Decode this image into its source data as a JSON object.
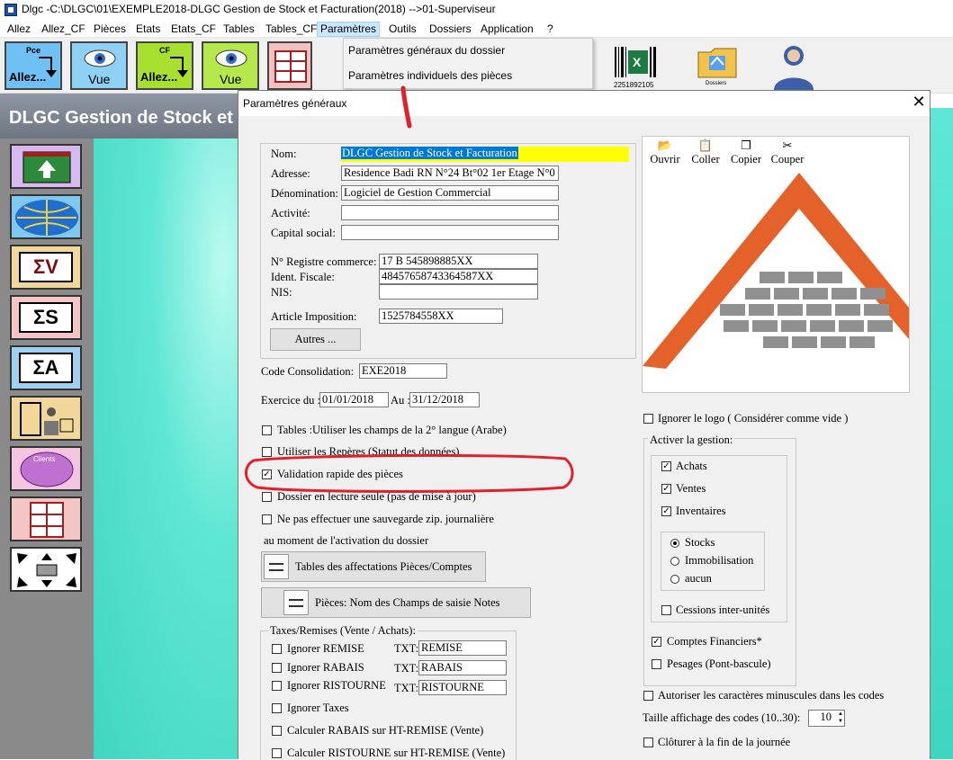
{
  "window": {
    "title": "Dlgc -C:\\DLGC\\01\\EXEMPLE2018-DLGC Gestion de Stock et Facturation(2018) -->01-Superviseur"
  },
  "menu": [
    "Allez",
    "Allez_CF",
    "Pièces",
    "Etats",
    "Etats_CF",
    "Tables",
    "Tables_CF",
    "Paramètres",
    "Outils",
    "Dossiers",
    "Application",
    "?"
  ],
  "toolbar": {
    "pce_label": "Pce",
    "allez_label": "Allez...",
    "vue_label": "Vue",
    "cf_label": "CF",
    "barcode_digits": "2251892105",
    "dossiers_label": "Dossiers"
  },
  "dropdown": {
    "item1": "Paramètres généraux du dossier",
    "item2": "Paramètres individuels des pièces"
  },
  "app": {
    "banner": "DLGC Gestion de Stock et Facturation",
    "clients_label": "Clients"
  },
  "dialog": {
    "title": "Paramètres généraux",
    "close": "✕",
    "fields": {
      "nom_label": "Nom:",
      "nom_value": "DLGC Gestion de Stock et Facturation",
      "adresse_label": "Adresse:",
      "adresse_value": "Residence Badi RN N°24 Bt°02 1er Etage N°0",
      "denomination_label": "Dénomination:",
      "denomination_value": "Logiciel de Gestion Commercial",
      "activite_label": "Activité:",
      "activite_value": "",
      "capital_label": "Capital social:",
      "capital_value": "",
      "rc_label": "N° Registre commerce:",
      "rc_value": "17 B 545898885XX",
      "if_label": "Ident. Fiscale:",
      "if_value": "48457658743364587XX",
      "nis_label": "NIS:",
      "nis_value": "",
      "article_label": "Article Imposition:",
      "article_value": "1525784558XX",
      "autres_button": "Autres ..."
    },
    "consolidation_label": "Code Consolidation:",
    "consolidation_value": "EXE2018",
    "exercice_label": "Exercice du :",
    "exercice_from": "01/01/2018",
    "au_label": "Au :",
    "exercice_to": "31/12/2018",
    "options": {
      "tables_arabe": "Tables :Utiliser les champs de la 2° langue (Arabe)",
      "reperes": "Utiliser les Repères (Statut des données)",
      "validation": "Validation rapide des pièces",
      "lecture_seule": "Dossier en lecture seule (pas de mise à jour)",
      "sauvegarde": "Ne pas effectuer une sauvegarde zip. journalière",
      "sauvegarde_note": "au moment de l'activation du dossier"
    },
    "btn_affectations": "Tables des affectations Pièces/Comptes",
    "btn_champs": "Pièces: Nom des Champs de saisie Notes",
    "taxes": {
      "legend": "Taxes/Remises (Vente / Achats):",
      "ignorer_remise": "Ignorer REMISE",
      "ignorer_rabais": "Ignorer RABAIS",
      "ignorer_ristourne": "Ignorer RISTOURNE",
      "txt_label": "TXT:",
      "txt_remise": "REMISE",
      "txt_rabais": "RABAIS",
      "txt_ristourne": "RISTOURNE",
      "ignorer_taxes": "Ignorer Taxes",
      "calc_rabais": "Calculer RABAIS sur HT-REMISE (Vente)",
      "calc_ristourne": "Calculer RISTOURNE sur HT-REMISE (Vente)"
    },
    "logo_tools": {
      "ouvrir": "Ouvrir",
      "coller": "Coller",
      "copier": "Copier",
      "couper": "Couper"
    },
    "ignorer_logo": "Ignorer le logo ( Considérer comme vide )",
    "gestion": {
      "legend": "Activer la gestion:",
      "achats": "Achats",
      "ventes": "Ventes",
      "inventaires": "Inventaires",
      "stocks": "Stocks",
      "immobilisation": "Immobilisation",
      "aucun": "aucun",
      "cessions": "Cessions inter-unités",
      "comptes_financiers": "Comptes Financiers*",
      "pesages": "Pesages (Pont-bascule)"
    },
    "minuscules": "Autoriser les caractères minuscules dans les codes",
    "taille_label": "Taille affichage des codes (10..30):",
    "taille_value": "10",
    "cloturer": "Clôturer à la fin de la journée"
  },
  "colors": {
    "highlight": "#ffff00",
    "selection": "#0078d7",
    "annotation_red": "#e0202a",
    "teal": "#40d6c0"
  }
}
